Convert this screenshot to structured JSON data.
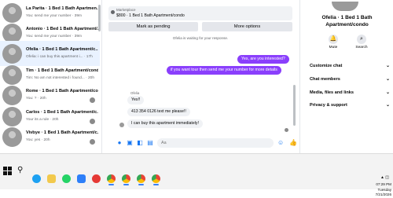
{
  "conversations": [
    {
      "name": "La Parita · 1 Bed 1 Bath Apartmen...",
      "snippet": "You: send me your number · 39m",
      "active": false
    },
    {
      "name": "Antonio · 1 Bed 1 Bath Apartment/...",
      "snippet": "You: send me your number · 39m",
      "active": false
    },
    {
      "name": "Ofelia · 1 Bed 1 Bath Apartment/c...",
      "snippet": "Ofelia: i can buy this apartment i... · 17h",
      "active": true
    },
    {
      "name": "Tim · 1 Bed 1 Bath Apartment/condo",
      "snippet": "Tim: No am not interested i found... · 20h",
      "active": false
    },
    {
      "name": "Rome · 1 Bed 1 Bath Apartment/co...",
      "snippet": "You: ? · 20h",
      "active": false
    },
    {
      "name": "Carlos · 1 Bed 1 Bath Apartment/c...",
      "snippet": "Your its a rule · 20h",
      "active": false
    },
    {
      "name": "Vivbye · 1 Bed 1 Bath Apartment/c...",
      "snippet": "You: yes · 20h",
      "active": false
    }
  ],
  "chat": {
    "marketplace_label": "Marketplace",
    "listing_title": "$800 · 1 Bed 1 Bath Apartment/condo",
    "mark_pending": "Mark as pending",
    "more_options": "More options",
    "waiting_text": "Ofelia is waiting for your response.",
    "outgoing": [
      "Yes, are you interested?",
      "if you want tour then send me your number for more details"
    ],
    "sender_name": "Ofelia",
    "incoming": [
      "Yes!!",
      "413 354 0126 text me please!!",
      "I can buy this apartment immediately!"
    ],
    "input_value": "Aa"
  },
  "profile": {
    "name_line1": "Ofelia · 1 Bed 1 Bath",
    "name_line2": "Apartment/condo",
    "mute_label": "Mute",
    "search_label": "Search",
    "sections": [
      "Customize chat",
      "Chat members",
      "Media, files and links",
      "Privacy & support"
    ]
  },
  "taskbar": {
    "time": "07:29 PM",
    "day": "Tuesday",
    "date": "7/21/2026"
  },
  "colors": {
    "accent": "#8a3ffc",
    "brand_blue": "#1877f2"
  }
}
